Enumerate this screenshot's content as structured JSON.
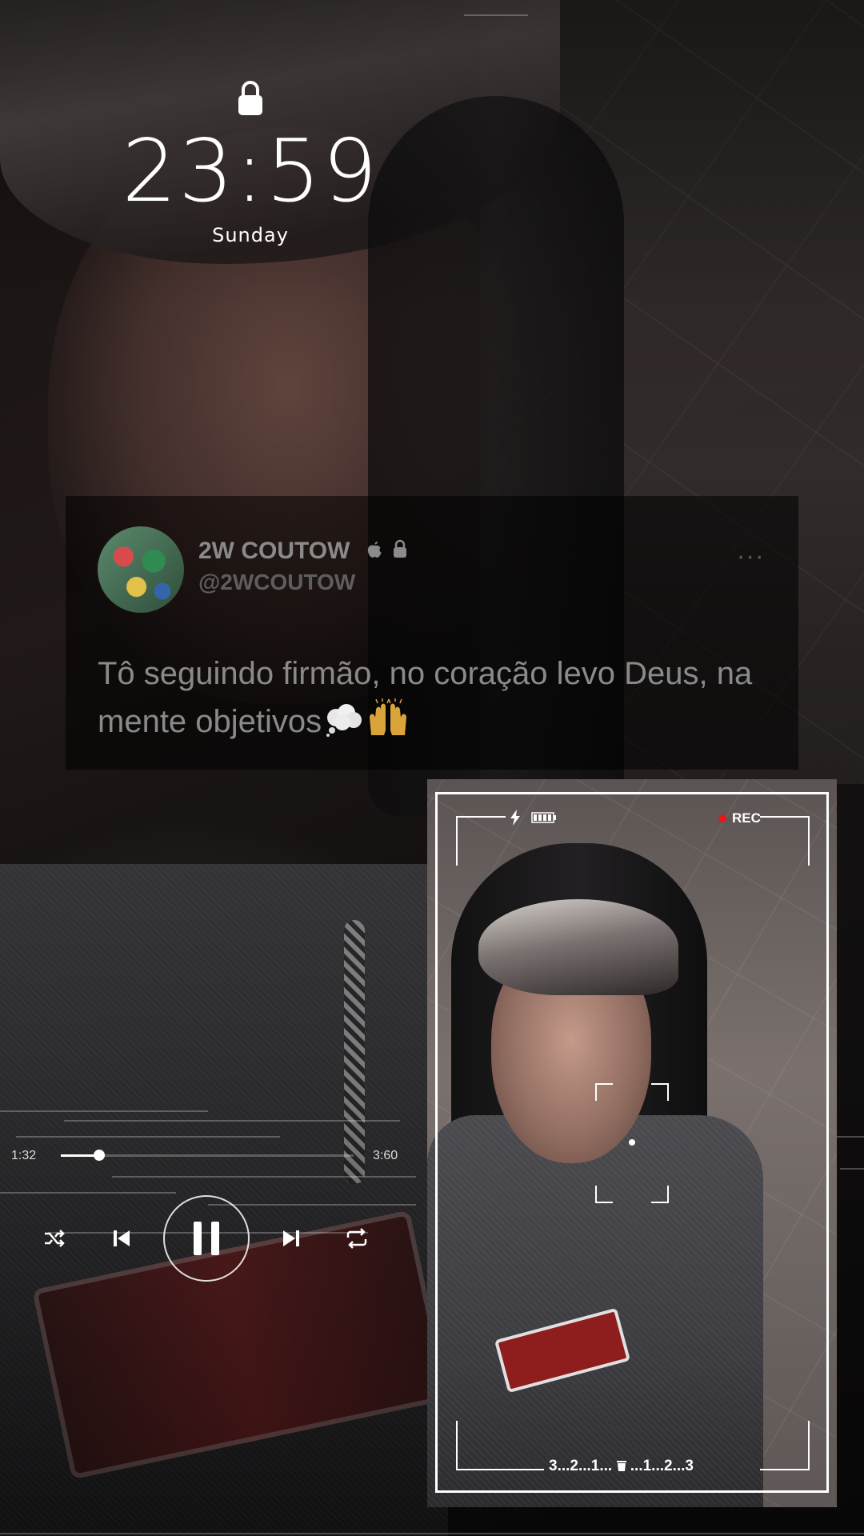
{
  "lock_screen": {
    "time": "23:59",
    "weekday": "Sunday"
  },
  "tweet": {
    "display_name": "2W COUTOW",
    "handle": "@2WCOUTOW",
    "text": "Tô seguindo firmão, no coração levo Deus, na mente objetivos",
    "emojis": [
      "thought-balloon-icon",
      "raising-hands-icon"
    ],
    "badges": [
      "apple-icon",
      "lock-icon"
    ],
    "more_label": "···"
  },
  "player": {
    "elapsed": "1:32",
    "duration": "3:60",
    "progress_fraction": 0.13,
    "controls": [
      "shuffle-icon",
      "previous-icon",
      "pause-icon",
      "next-icon",
      "repeat-icon"
    ]
  },
  "camera_overlay": {
    "rec_label": "REC",
    "countdown": "3...2...1...",
    "countdown_after": "...1...2...3",
    "icons": [
      "flash-icon",
      "battery-icon",
      "rec-dot-icon",
      "trash-icon"
    ]
  },
  "colors": {
    "text_primary": "#ffffff",
    "tweet_text": "#8a8a8a",
    "tweet_handle": "#5e5e5e",
    "rec_red": "#e01919"
  }
}
